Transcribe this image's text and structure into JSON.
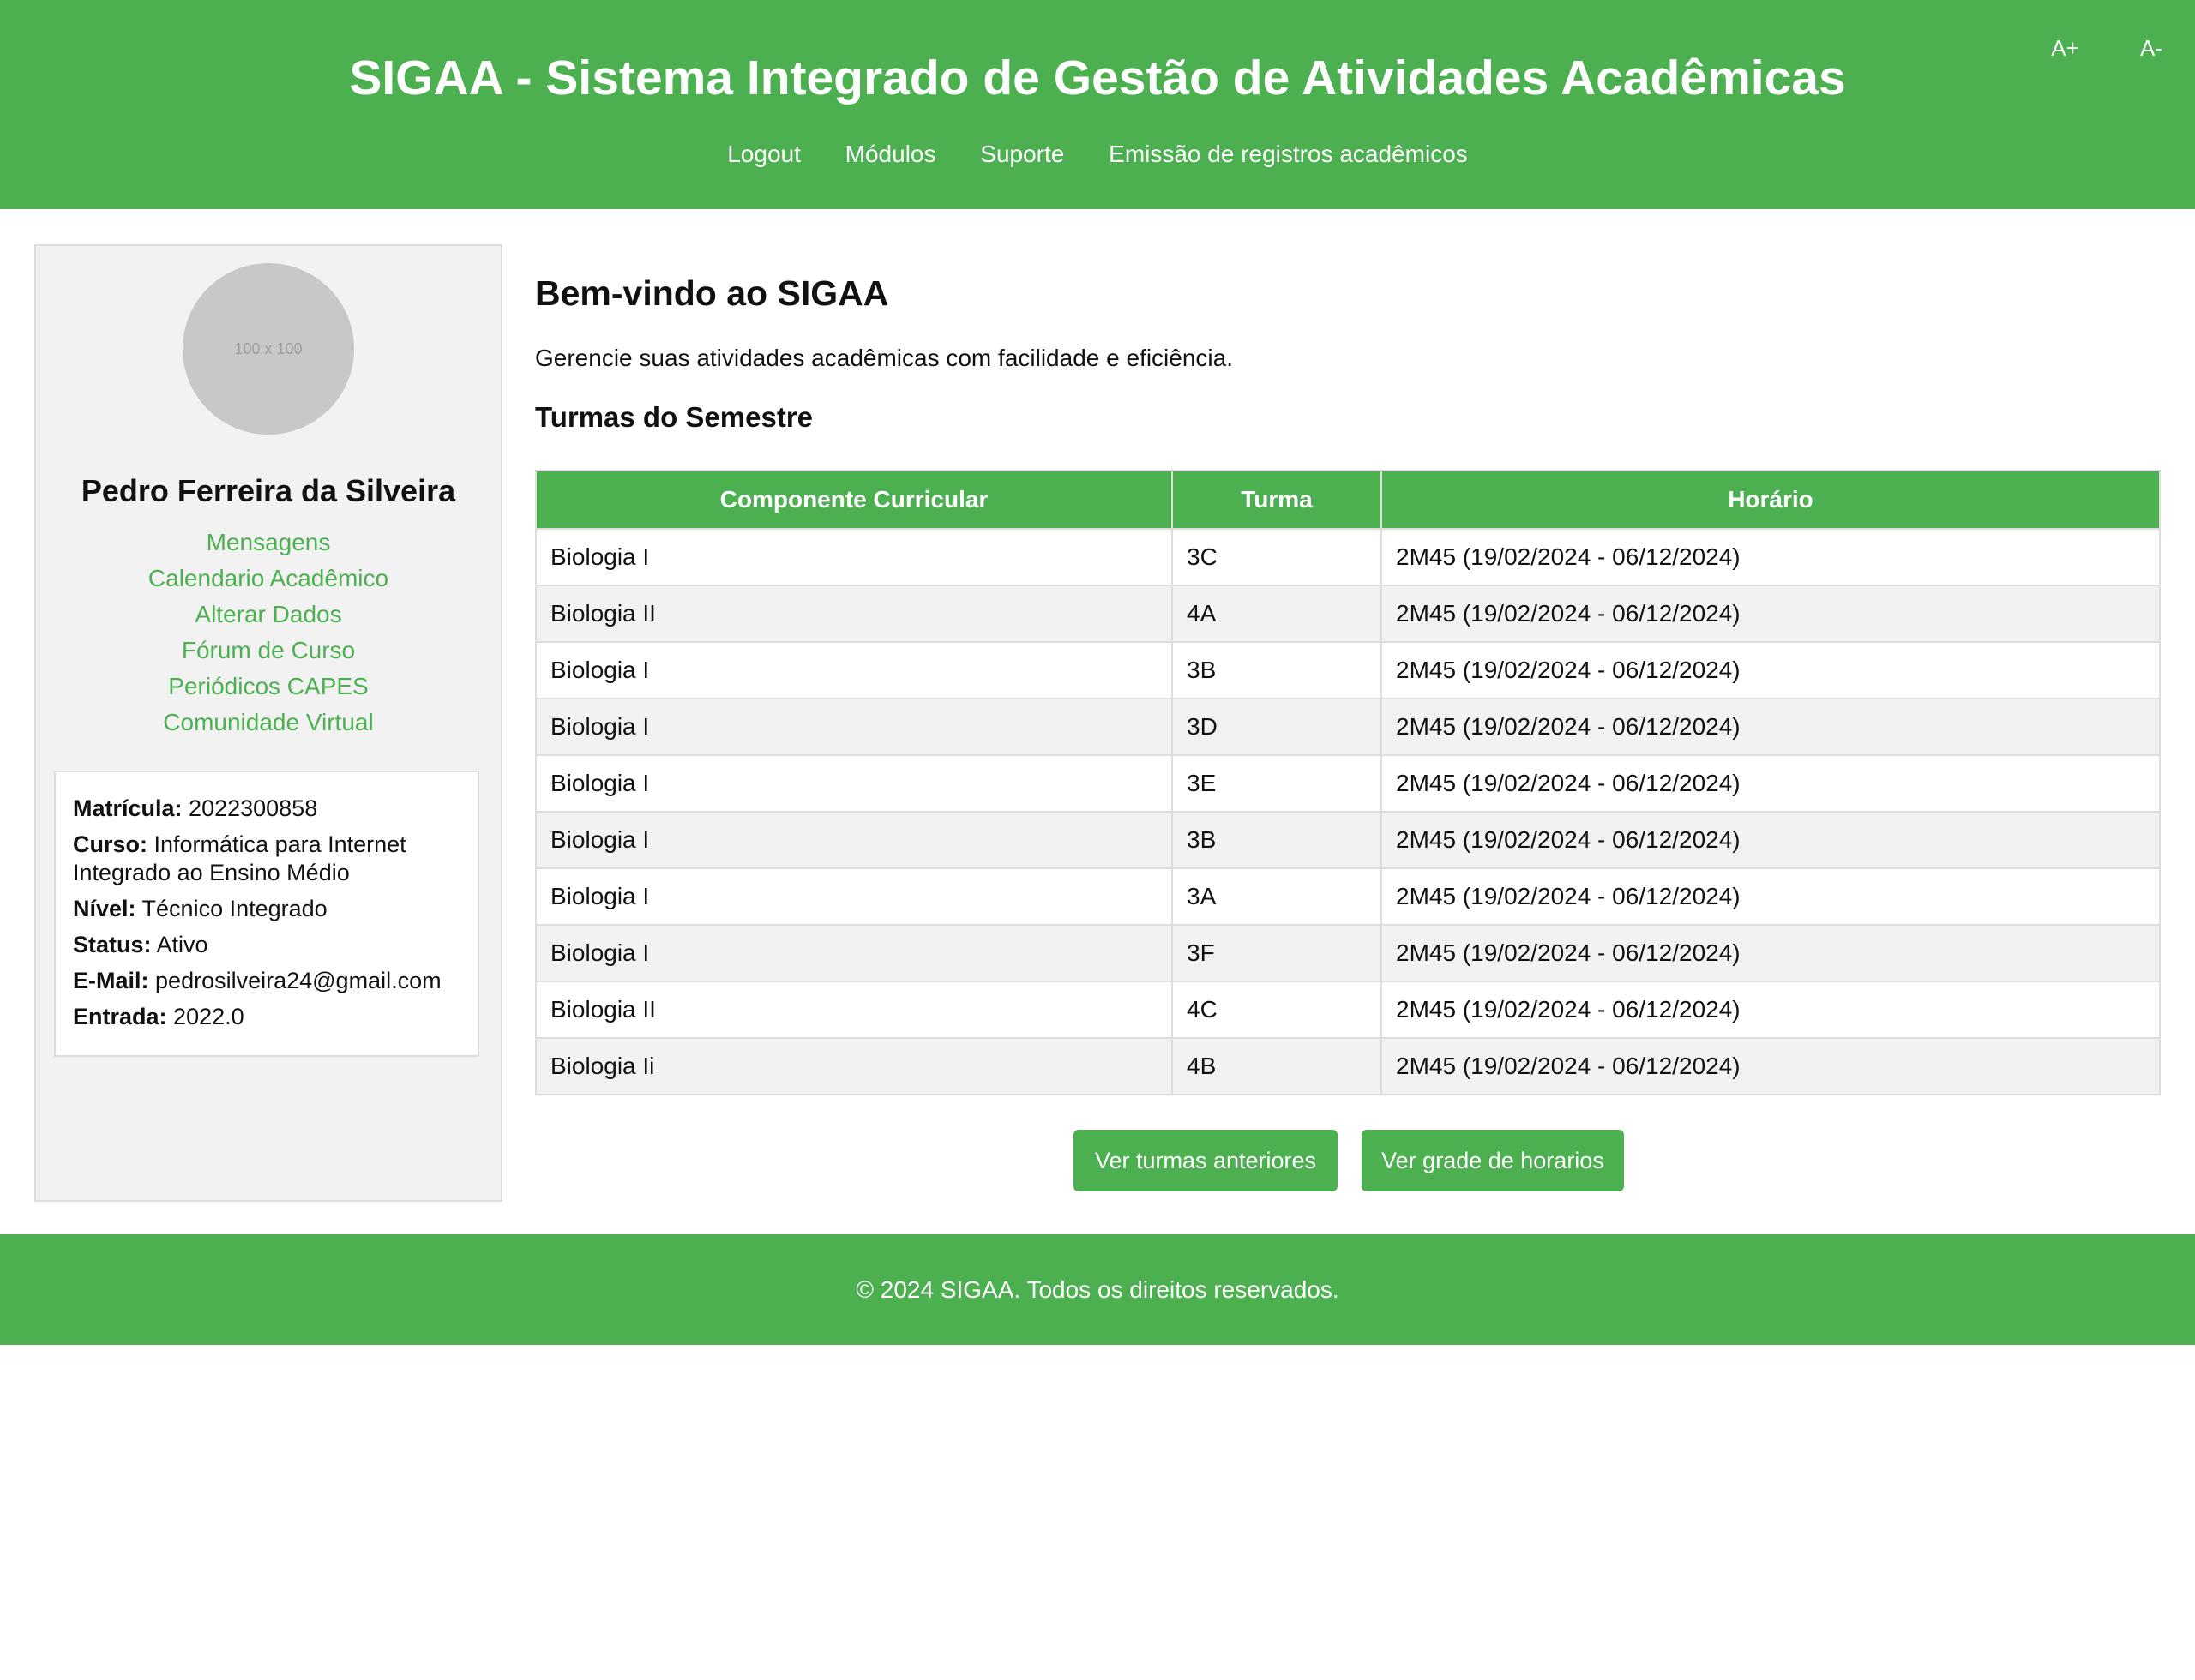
{
  "header": {
    "title": "SIGAA - Sistema Integrado de Gestão de Atividades Acadêmicas",
    "nav": [
      "Logout",
      "Módulos",
      "Suporte",
      "Emissão de registros acadêmicos"
    ],
    "font_increase": "A+",
    "font_decrease": "A-"
  },
  "sidebar": {
    "avatar_text": "100 x 100",
    "user_name": "Pedro Ferreira da Silveira",
    "links": [
      "Mensagens",
      "Calendario Acadêmico",
      "Alterar Dados",
      "Fórum de Curso",
      "Periódicos CAPES",
      "Comunidade Virtual"
    ],
    "info": [
      {
        "label": "Matrícula:",
        "value": "2022300858"
      },
      {
        "label": "Curso:",
        "value": "Informática para Internet Integrado ao Ensino Médio"
      },
      {
        "label": "Nível:",
        "value": "Técnico Integrado"
      },
      {
        "label": "Status:",
        "value": "Ativo"
      },
      {
        "label": "E-Mail:",
        "value": "pedrosilveira24@gmail.com"
      },
      {
        "label": "Entrada:",
        "value": "2022.0"
      }
    ]
  },
  "main": {
    "title": "Bem-vindo ao SIGAA",
    "subtitle": "Gerencie suas atividades acadêmicas com facilidade e eficiência.",
    "section_title": "Turmas do Semestre",
    "table": {
      "headers": [
        "Componente Curricular",
        "Turma",
        "Horário"
      ],
      "rows": [
        [
          "Biologia I",
          "3C",
          "2M45 (19/02/2024 - 06/12/2024)"
        ],
        [
          "Biologia II",
          "4A",
          "2M45 (19/02/2024 - 06/12/2024)"
        ],
        [
          "Biologia I",
          "3B",
          "2M45 (19/02/2024 - 06/12/2024)"
        ],
        [
          "Biologia I",
          "3D",
          "2M45 (19/02/2024 - 06/12/2024)"
        ],
        [
          "Biologia I",
          "3E",
          "2M45 (19/02/2024 - 06/12/2024)"
        ],
        [
          "Biologia I",
          "3B",
          "2M45 (19/02/2024 - 06/12/2024)"
        ],
        [
          "Biologia I",
          "3A",
          "2M45 (19/02/2024 - 06/12/2024)"
        ],
        [
          "Biologia I",
          "3F",
          "2M45 (19/02/2024 - 06/12/2024)"
        ],
        [
          "Biologia II",
          "4C",
          "2M45 (19/02/2024 - 06/12/2024)"
        ],
        [
          "Biologia Ii",
          "4B",
          "2M45 (19/02/2024 - 06/12/2024)"
        ]
      ]
    },
    "buttons": {
      "previous_classes": "Ver turmas anteriores",
      "schedule_grid": "Ver grade de horarios"
    }
  },
  "footer": {
    "text": "© 2024 SIGAA. Todos os direitos reservados."
  },
  "colors": {
    "primary_green": "#4caf50",
    "sidebar_bg": "#f2f2f2",
    "border": "#dddddd"
  }
}
